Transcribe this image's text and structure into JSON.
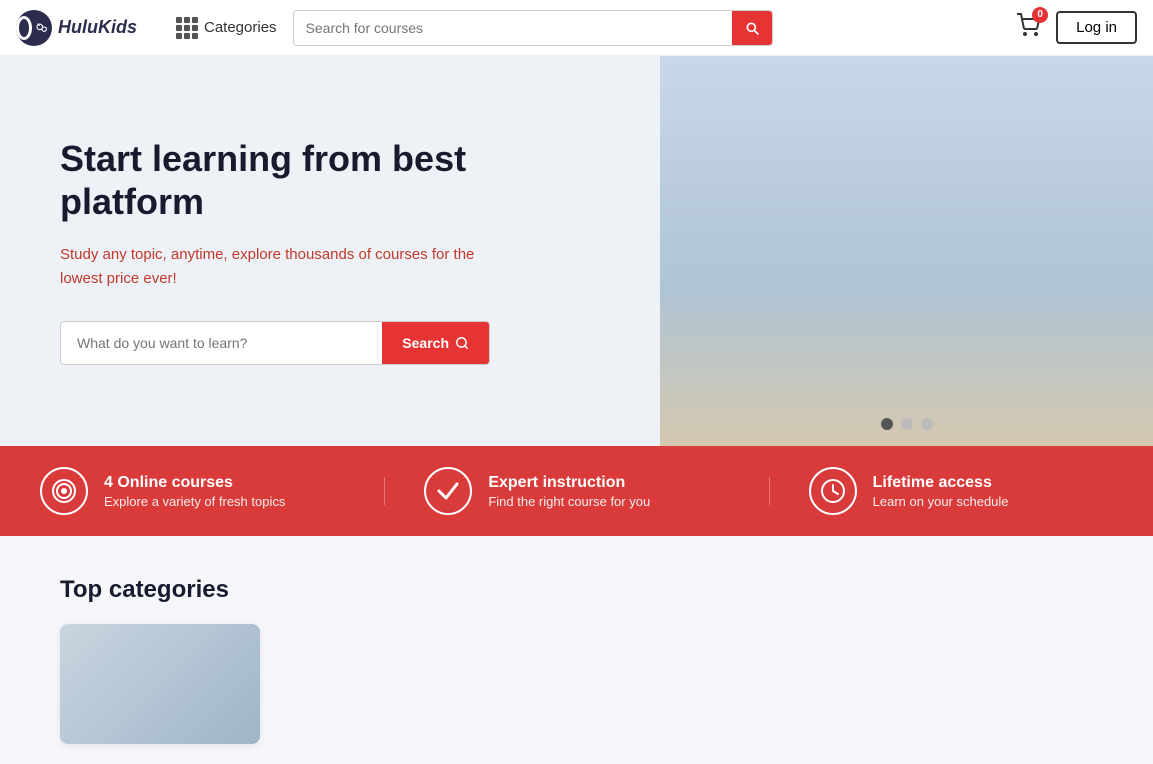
{
  "navbar": {
    "logo_text": "HuluKids",
    "categories_label": "Categories",
    "search_placeholder": "Search for courses",
    "cart_badge": "0",
    "login_label": "Log in"
  },
  "hero": {
    "title": "Start learning from best platform",
    "subtitle": "Study any topic, anytime, explore thousands of courses for the lowest price ever!",
    "search_placeholder": "What do you want to learn?",
    "search_button": "Search",
    "carousel_dots": [
      "active",
      "inactive",
      "inactive"
    ]
  },
  "features": [
    {
      "icon": "target",
      "title": "4 Online courses",
      "subtitle": "Explore a variety of fresh topics"
    },
    {
      "icon": "check",
      "title": "Expert instruction",
      "subtitle": "Find the right course for you"
    },
    {
      "icon": "clock",
      "title": "Lifetime access",
      "subtitle": "Learn on your schedule"
    }
  ],
  "bottom": {
    "section_title": "Top categories"
  },
  "icons": {
    "search": "🔍",
    "cart": "🛒",
    "target": "◎",
    "check": "✔",
    "clock": "🕐"
  }
}
